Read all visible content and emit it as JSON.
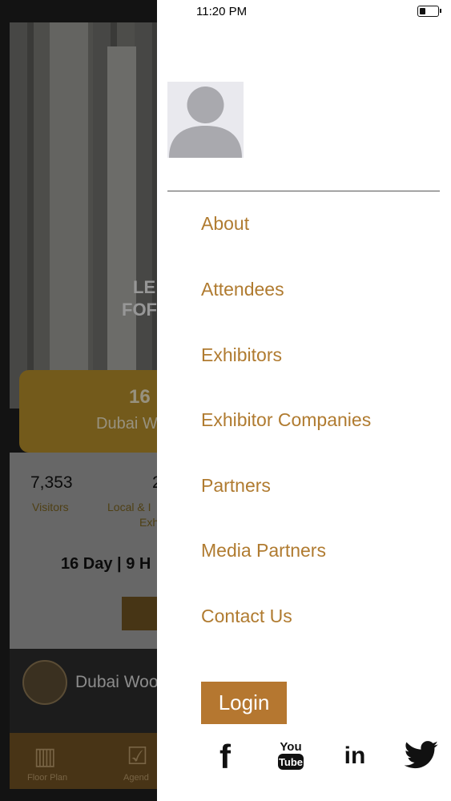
{
  "status_bar": {
    "time": "11:20 PM"
  },
  "background_app": {
    "hero_text_1": "LE",
    "hero_text_2": "FOF",
    "banner_number": "16",
    "banner_text": "Dubai W",
    "stats": [
      {
        "value": "7,353",
        "label": "Visitors"
      },
      {
        "value": "2",
        "label": "Local & I",
        "label2": "Exh"
      }
    ],
    "countdown": "16 Day | 9 H",
    "event_name": "Dubai Woo",
    "tabs": [
      {
        "label": "Floor Plan",
        "icon": "map-icon"
      },
      {
        "label": "Agend",
        "icon": "calendar-icon"
      }
    ]
  },
  "drawer": {
    "avatar_icon": "user-avatar-icon",
    "menu": [
      {
        "label": "About"
      },
      {
        "label": "Attendees"
      },
      {
        "label": "Exhibitors"
      },
      {
        "label": "Exhibitor Companies"
      },
      {
        "label": "Partners"
      },
      {
        "label": "Media Partners"
      },
      {
        "label": "Contact Us"
      }
    ],
    "login_label": "Login",
    "social": [
      {
        "name": "facebook-icon",
        "text": "f"
      },
      {
        "name": "youtube-icon",
        "text": "You",
        "text2": "Tube"
      },
      {
        "name": "linkedin-icon",
        "text": "in"
      },
      {
        "name": "twitter-icon"
      }
    ]
  },
  "colors": {
    "accent": "#B07B30",
    "login_bg": "#B57730",
    "divider": "#555555"
  }
}
